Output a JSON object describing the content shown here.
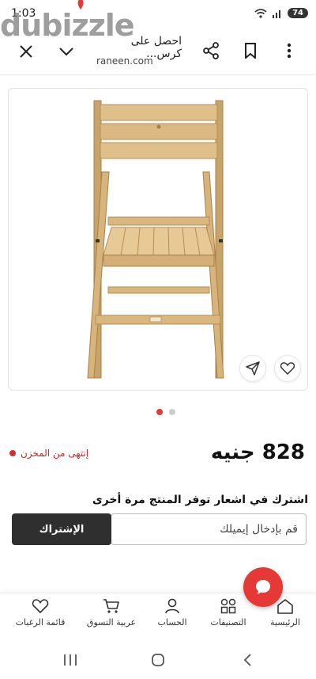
{
  "status_bar": {
    "time": "1:03",
    "battery": "74"
  },
  "watermark": "dubizzle",
  "browser": {
    "page_title": "احصل على كرس...",
    "domain": "raneen.com"
  },
  "icons": {
    "close": "close-icon",
    "chevron": "chevron-down-icon",
    "share": "share-icon",
    "bookmark": "bookmark-icon",
    "menu": "more-vertical-icon",
    "send": "send-icon",
    "heart": "heart-icon",
    "chat": "chat-icon"
  },
  "gallery": {
    "total": 2,
    "active": 1
  },
  "product": {
    "price": "828 جنيه",
    "stock_status": "إنتهى من المخزن"
  },
  "notify": {
    "title": "اشترك في اشعار توفر المنتج مرة أخرى",
    "email_placeholder": "قم بإدخال إيميلك",
    "button": "الإشتراك"
  },
  "bottom_nav": {
    "home": "الرئيسية",
    "categories": "التصنيفات",
    "account": "الحساب",
    "cart": "عربية التسوق",
    "wishlist": "قائمة الرغبات"
  },
  "colors": {
    "accent": "#e53935",
    "dark_button": "#2f2f2f",
    "stock_red": "#c62828"
  }
}
